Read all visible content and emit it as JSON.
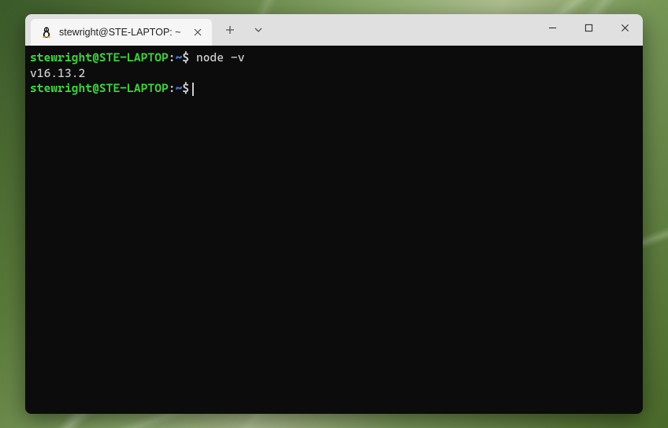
{
  "tab": {
    "title": "stewright@STE-LAPTOP: ~"
  },
  "terminal": {
    "lines": [
      {
        "user_host": "stewright@STE-LAPTOP",
        "colon": ":",
        "path": "~",
        "dollar": "$",
        "command": " node -v"
      },
      {
        "output": "v16.13.2"
      },
      {
        "user_host": "stewright@STE-LAPTOP",
        "colon": ":",
        "path": "~",
        "dollar": "$",
        "command": "",
        "cursor": true
      }
    ]
  }
}
